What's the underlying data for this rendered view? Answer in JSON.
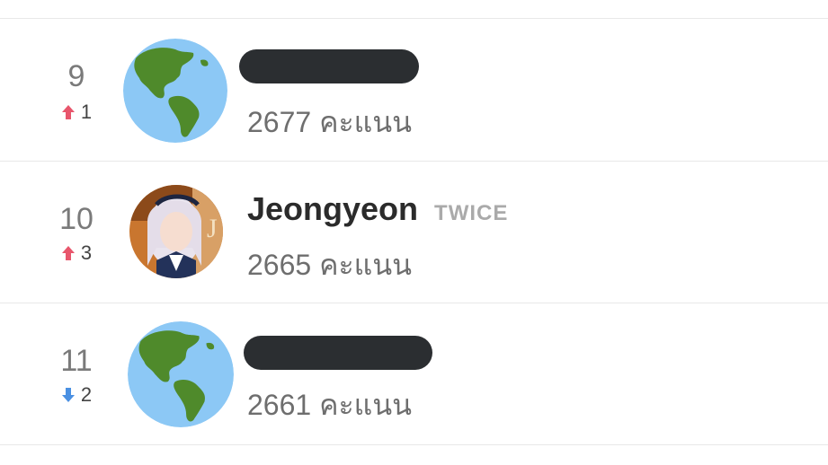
{
  "ranking": {
    "rows": [
      {
        "rank": "9",
        "change_direction": "up",
        "change": "1",
        "name": "",
        "group": "",
        "score": "2677",
        "score_unit": "คะแนน",
        "avatar_icon": "globe-icon",
        "name_redacted": true
      },
      {
        "rank": "10",
        "change_direction": "up",
        "change": "3",
        "name": "Jeongyeon",
        "group": "TWICE",
        "score": "2665",
        "score_unit": "คะแนน",
        "avatar_icon": "photo-avatar",
        "name_redacted": false
      },
      {
        "rank": "11",
        "change_direction": "down",
        "change": "2",
        "name": "",
        "group": "",
        "score": "2661",
        "score_unit": "คะแนน",
        "avatar_icon": "globe-icon",
        "name_redacted": true
      }
    ]
  },
  "colors": {
    "up_arrow": "#e8566c",
    "down_arrow": "#4a90e2",
    "redaction": "#2b2e31",
    "globe_ocean": "#8cc8f5",
    "globe_land": "#4f8a2b"
  }
}
